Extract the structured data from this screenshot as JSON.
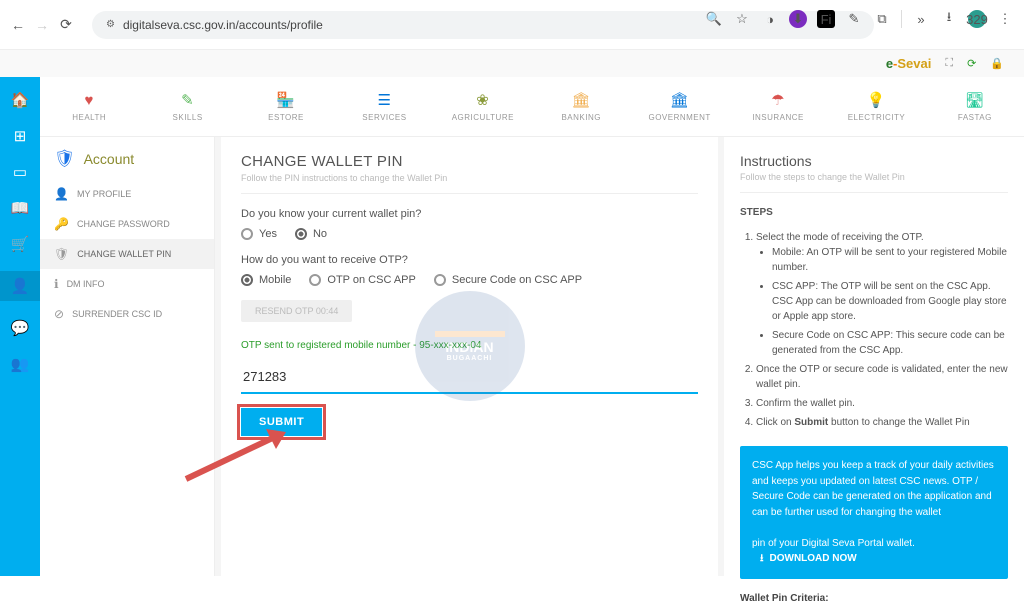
{
  "browser": {
    "url": "digitalseva.csc.gov.in/accounts/profile"
  },
  "brand": {
    "e": "e",
    "dash": "-",
    "s": "Sevai"
  },
  "cats": [
    {
      "label": "HEALTH",
      "ico": "♥",
      "cls": "c-red"
    },
    {
      "label": "SKILLS",
      "ico": "✎",
      "cls": "c-green"
    },
    {
      "label": "ESTORE",
      "ico": "🏪",
      "cls": "c-orange"
    },
    {
      "label": "SERVICES",
      "ico": "☰",
      "cls": "c-blue"
    },
    {
      "label": "AGRICULTURE",
      "ico": "❀",
      "cls": "c-olive"
    },
    {
      "label": "BANKING",
      "ico": "🏛",
      "cls": "c-orange"
    },
    {
      "label": "GOVERNMENT",
      "ico": "🏛",
      "cls": "c-blue"
    },
    {
      "label": "INSURANCE",
      "ico": "☂",
      "cls": "c-red"
    },
    {
      "label": "ELECTRICITY",
      "ico": "💡",
      "cls": "c-yellow"
    },
    {
      "label": "FASTAG",
      "ico": "🛣",
      "cls": "c-teal"
    }
  ],
  "side": {
    "head": "Account",
    "items": [
      {
        "ico": "👤",
        "label": "MY PROFILE"
      },
      {
        "ico": "🔑",
        "label": "CHANGE PASSWORD"
      },
      {
        "ico": "🛡",
        "label": "CHANGE WALLET PIN",
        "active": true
      },
      {
        "ico": "ℹ",
        "label": "DM INFO"
      },
      {
        "ico": "⊘",
        "label": "SURRENDER CSC ID"
      }
    ]
  },
  "form": {
    "title": "CHANGE WALLET PIN",
    "sub": "Follow the PIN instructions to change the Wallet Pin",
    "q1": "Do you know your current wallet pin?",
    "yes": "Yes",
    "no": "No",
    "q2": "How do you want to receive OTP?",
    "opt1": "Mobile",
    "opt2": "OTP on CSC APP",
    "opt3": "Secure Code on CSC APP",
    "resend": "RESEND OTP 00:44",
    "otpmsg": "OTP sent to registered mobile number - 95-xxx-xxx-04",
    "otpval": "271283",
    "submit": "SUBMIT"
  },
  "instr": {
    "title": "Instructions",
    "sub": "Follow the steps to change the Wallet Pin",
    "stepsh": "STEPS",
    "s1": "Select the mode of receiving the OTP.",
    "s1a": "Mobile: An OTP will be sent to your registered Mobile number.",
    "s1b": "CSC APP: The OTP will be sent on the CSC App. CSC App can be downloaded from Google play store or Apple app store.",
    "s1c": "Secure Code on CSC APP: This secure code can be generated from the CSC App.",
    "s2": "Once the OTP or secure code is validated, enter the new wallet pin.",
    "s3": "Confirm the wallet pin.",
    "s4a": "Click on ",
    "s4b": "Submit",
    "s4c": " button to change the Wallet Pin",
    "promo": "CSC App helps you keep a track of your daily activities and keeps you updated on latest CSC news. OTP / Secure Code can be generated on the application and can be further used for changing the wallet",
    "promo2": "pin of your Digital Seva Portal wallet.",
    "dl": "DOWNLOAD NOW",
    "crit": "Wallet Pin Criteria:"
  },
  "watermark": {
    "t1": "INDIAN",
    "t2": "BUGAACHI"
  }
}
